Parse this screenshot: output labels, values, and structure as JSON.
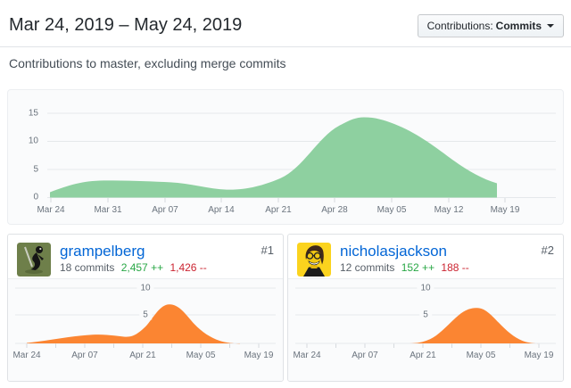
{
  "header": {
    "title": "Mar 24, 2019 – May 24, 2019",
    "filter_label": "Contributions:",
    "filter_value": "Commits",
    "subtitle": "Contributions to master, excluding merge commits"
  },
  "colors": {
    "green_area": "#8ed0a0",
    "orange_area": "#fb8532",
    "link_blue": "#0366d6",
    "additions_green": "#28a745",
    "deletions_red": "#cb2431",
    "panel_bg": "#fafbfc",
    "grid_line": "#e5e8eb"
  },
  "main_chart": {
    "y_ticks": [
      "15",
      "10",
      "5",
      "0"
    ],
    "x_ticks": [
      "Mar 24",
      "Mar 31",
      "Apr 07",
      "Apr 14",
      "Apr 21",
      "Apr 28",
      "May 05",
      "May 12",
      "May 19"
    ]
  },
  "contributors": [
    {
      "rank": "#1",
      "username": "grampelberg",
      "commits": "18 commits",
      "additions": "2,457 ++",
      "deletions": "1,426 --",
      "y_ticks": [
        "10",
        "5"
      ],
      "x_ticks": [
        "Mar 24",
        "Apr 07",
        "Apr 21",
        "May 05",
        "May 19"
      ]
    },
    {
      "rank": "#2",
      "username": "nicholasjackson",
      "commits": "12 commits",
      "additions": "152 ++",
      "deletions": "188 --",
      "y_ticks": [
        "10",
        "5"
      ],
      "x_ticks": [
        "Mar 24",
        "Apr 07",
        "Apr 21",
        "May 05",
        "May 19"
      ]
    }
  ],
  "chart_data": [
    {
      "type": "area",
      "title": "Contributions to master, excluding merge commits (all contributors, commits per week)",
      "categories": [
        "Mar 24",
        "Mar 31",
        "Apr 07",
        "Apr 14",
        "Apr 21",
        "Apr 28",
        "May 05",
        "May 12",
        "May 19"
      ],
      "values": [
        1,
        3,
        3,
        1.5,
        3.5,
        11.5,
        13.5,
        7,
        2.5
      ],
      "peak_value_approx": 14,
      "ylim": [
        0,
        15
      ],
      "yticks": [
        0,
        5,
        10,
        15
      ],
      "color": "#8ed0a0",
      "grid": true,
      "legend": "none"
    },
    {
      "type": "area",
      "title": "grampelberg commits per week",
      "categories": [
        "Mar 24",
        "Mar 31",
        "Apr 07",
        "Apr 14",
        "Apr 21",
        "Apr 28",
        "May 05",
        "May 12",
        "May 19"
      ],
      "values": [
        0.2,
        1,
        1.7,
        1.2,
        4,
        7.2,
        2,
        0.2,
        0
      ],
      "ylim": [
        0,
        12
      ],
      "yticks": [
        5,
        10
      ],
      "color": "#fb8532",
      "grid": true,
      "legend": "none"
    },
    {
      "type": "area",
      "title": "nicholasjackson commits per week",
      "categories": [
        "Mar 24",
        "Mar 31",
        "Apr 07",
        "Apr 14",
        "Apr 21",
        "Apr 28",
        "May 05",
        "May 12",
        "May 19"
      ],
      "values": [
        0,
        0,
        0,
        0,
        0.3,
        4.5,
        6.5,
        1.5,
        0
      ],
      "ylim": [
        0,
        12
      ],
      "yticks": [
        5,
        10
      ],
      "color": "#fb8532",
      "grid": true,
      "legend": "none"
    }
  ]
}
